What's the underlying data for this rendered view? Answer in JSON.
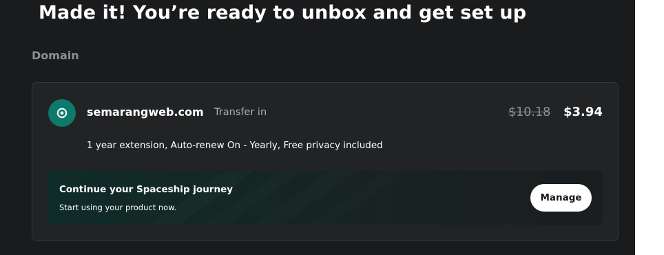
{
  "header": {
    "title": "Made it! You’re ready to unbox and get set up"
  },
  "section": {
    "label": "Domain"
  },
  "domain_item": {
    "icon": "domain-target-icon",
    "name": "semarangweb.com",
    "action": "Transfer in",
    "original_price": "$10.18",
    "price": "$3.94",
    "details": "1 year extension, Auto-renew On - Yearly, Free privacy included"
  },
  "journey": {
    "title": "Continue your Spaceship journey",
    "subtitle": "Start using your product now.",
    "button_label": "Manage"
  },
  "colors": {
    "background": "#1a1b1d",
    "card": "#222325",
    "accent": "#0e7a6b",
    "muted_text": "#8d8f94"
  }
}
